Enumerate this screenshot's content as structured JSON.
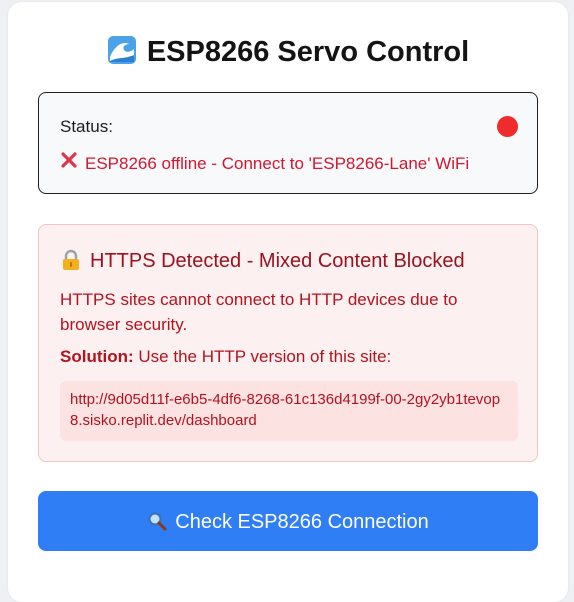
{
  "header": {
    "title": "ESP8266 Servo Control",
    "icon": "wave-icon"
  },
  "status": {
    "label": "Status:",
    "indicator_color": "#ef2b2b",
    "message": "ESP8266 offline - Connect to 'ESP8266-Lane' WiFi",
    "message_icon": "x-icon",
    "message_color": "#d3172f"
  },
  "warning": {
    "icon": "lock-icon",
    "title": "HTTPS Detected - Mixed Content Blocked",
    "body": "HTTPS sites cannot connect to HTTP devices due to browser security.",
    "solution_label": "Solution:",
    "solution_text": "Use the HTTP version of this site:",
    "url": "http://9d05d11f-e6b5-4df6-8268-61c136d4199f-00-2gy2yb1tevop8.sisko.replit.dev/dashboard",
    "text_color": "#b3131f",
    "title_color": "#9a1220"
  },
  "actions": {
    "check_label": "Check ESP8266 Connection",
    "check_icon": "magnifier-icon",
    "button_color": "#2f7ef6"
  }
}
